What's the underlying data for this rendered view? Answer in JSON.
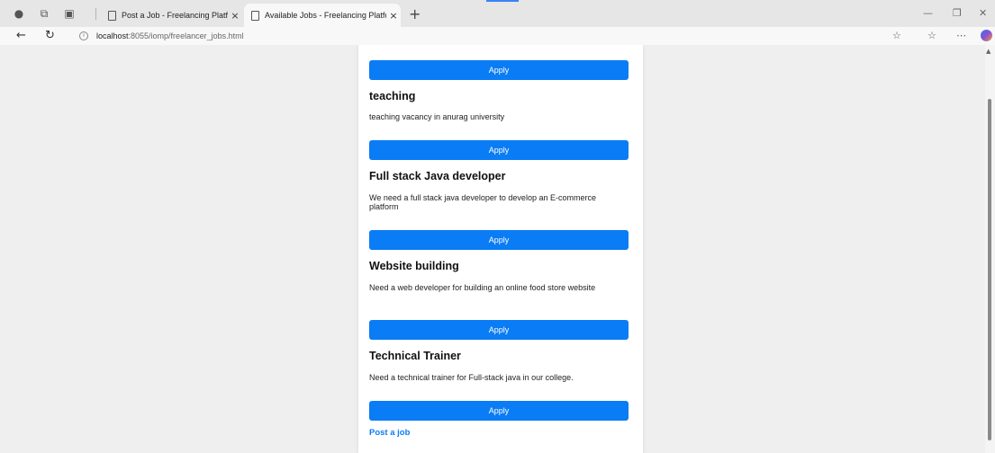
{
  "browser": {
    "tabs": [
      {
        "title": "Post a Job - Freelancing Platform",
        "active": false
      },
      {
        "title": "Available Jobs - Freelancing Platform",
        "active": true
      }
    ],
    "close_glyph": "×",
    "new_tab_glyph": "+",
    "address": {
      "host": "localhost",
      "path": ":8055/iomp/freelancer_jobs.html"
    },
    "icons": [
      "profile-icon",
      "workspaces-icon",
      "tab-actions-icon",
      "back-icon",
      "refresh-icon",
      "info-icon",
      "favorite-icon",
      "favorites-list-icon",
      "more-icon",
      "copilot-icon"
    ]
  },
  "page": {
    "apply_label": "Apply",
    "jobs": [
      {
        "title": "teaching",
        "description": "teaching vacancy in anurag university"
      },
      {
        "title": "Full stack Java developer",
        "description": "We need a full stack java developer to develop an E-commerce platform"
      },
      {
        "title": "Website building",
        "description": "Need a web developer for building an online food store website"
      },
      {
        "title": "Technical Trainer",
        "description": "Need a technical trainer for Full-stack java in our college."
      }
    ],
    "post_link": "Post a job"
  },
  "colors": {
    "accent": "#0a7cf5",
    "page_background": "#efefef",
    "card_background": "#ffffff"
  }
}
